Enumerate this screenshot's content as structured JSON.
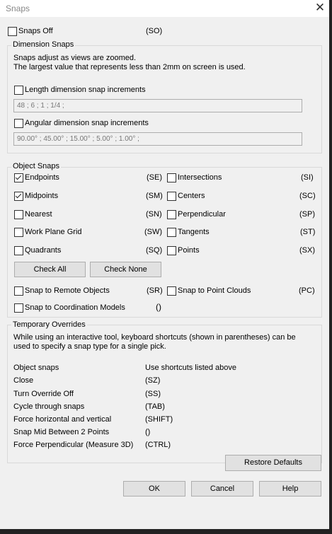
{
  "window": {
    "title": "Snaps",
    "close_glyph": "✕"
  },
  "snaps_off": {
    "label": "Snaps Off",
    "shortcut": "(SO)",
    "checked": false
  },
  "dimension": {
    "legend": "Dimension Snaps",
    "desc1": "Snaps adjust as views are zoomed.",
    "desc2": "The largest value that represents less than 2mm on screen is used.",
    "length_label": "Length dimension snap increments",
    "length_checked": false,
    "length_value": "48 ; 6 ; 1 ; 1/4 ;",
    "angular_label": "Angular dimension snap increments",
    "angular_checked": false,
    "angular_value": "90.00° ; 45.00° ; 15.00° ; 5.00° ; 1.00° ;"
  },
  "object": {
    "legend": "Object Snaps",
    "endpoints": {
      "label": "Endpoints",
      "code": "(SE)",
      "checked": true
    },
    "midpoints": {
      "label": "Midpoints",
      "code": "(SM)",
      "checked": true
    },
    "nearest": {
      "label": "Nearest",
      "code": "(SN)",
      "checked": false
    },
    "workplane": {
      "label": "Work Plane Grid",
      "code": "(SW)",
      "checked": false
    },
    "quadrants": {
      "label": "Quadrants",
      "code": "(SQ)",
      "checked": false
    },
    "intersections": {
      "label": "Intersections",
      "code": "(SI)",
      "checked": false
    },
    "centers": {
      "label": "Centers",
      "code": "(SC)",
      "checked": false
    },
    "perpendicular": {
      "label": "Perpendicular",
      "code": "(SP)",
      "checked": false
    },
    "tangents": {
      "label": "Tangents",
      "code": "(ST)",
      "checked": false
    },
    "points": {
      "label": "Points",
      "code": "(SX)",
      "checked": false
    },
    "check_all": "Check All",
    "check_none": "Check None",
    "remote": {
      "label": "Snap to Remote Objects",
      "code": "(SR)",
      "checked": false
    },
    "point_clouds": {
      "label": "Snap to Point Clouds",
      "code": "(PC)",
      "checked": false
    },
    "coordination": {
      "label": "Snap to Coordination Models",
      "code": "()",
      "checked": false
    }
  },
  "overrides": {
    "legend": "Temporary Overrides",
    "desc1": "While using an interactive tool, keyboard shortcuts (shown in parentheses) can be",
    "desc2": "used to specify a snap type for a single pick.",
    "rows": [
      {
        "label": "Object snaps",
        "value": "Use shortcuts listed above"
      },
      {
        "label": "Close",
        "value": "(SZ)"
      },
      {
        "label": "Turn Override Off",
        "value": "(SS)"
      },
      {
        "label": "Cycle through snaps",
        "value": "(TAB)"
      },
      {
        "label": "Force horizontal and vertical",
        "value": "(SHIFT)"
      },
      {
        "label": "Snap Mid Between 2 Points",
        "value": "()"
      },
      {
        "label": "Force Perpendicular (Measure 3D)",
        "value": "(CTRL)"
      }
    ]
  },
  "buttons": {
    "restore": "Restore Defaults",
    "ok": "OK",
    "cancel": "Cancel",
    "help": "Help"
  }
}
